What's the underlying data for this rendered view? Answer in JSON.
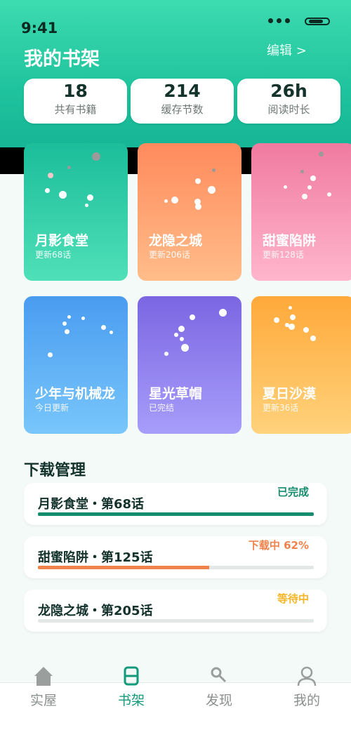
{
  "status_bar": {
    "time": "9:41"
  },
  "header": {
    "title": "我的书架",
    "edit_label": "编辑 >"
  },
  "stats": [
    {
      "value": "18",
      "label": "共有书籍"
    },
    {
      "value": "214",
      "label": "缓存节数"
    },
    {
      "value": "26h",
      "label": "阅读时长"
    }
  ],
  "books": [
    {
      "title": "月影食堂",
      "status": "更新68话",
      "gradient": [
        "#1bbd9a",
        "#4fe0b8"
      ]
    },
    {
      "title": "龙隐之城",
      "status": "更新206话",
      "gradient": [
        "#ff8a5c",
        "#ffbd8a"
      ]
    },
    {
      "title": "甜蜜陷阱",
      "status": "更新128话",
      "gradient": [
        "#f07aa0",
        "#ffb6cc"
      ]
    },
    {
      "title": "少年与机械龙",
      "status": "今日更新",
      "gradient": [
        "#4a9cf0",
        "#78c6fb"
      ]
    },
    {
      "title": "星光草帽",
      "status": "已完结",
      "gradient": [
        "#7b66e2",
        "#a79dfa"
      ]
    },
    {
      "title": "夏日沙漠",
      "status": "更新36话",
      "gradient": [
        "#ffa93a",
        "#ffd27c"
      ]
    }
  ],
  "downloads": {
    "section_title": "下载管理",
    "items": [
      {
        "title": "月影食堂・第68话",
        "status": "已完成",
        "status_color": "#148c6e",
        "progress": 1.0,
        "bar_color": "#148c6e"
      },
      {
        "title": "甜蜜陷阱・第125话",
        "status": "下载中 62%",
        "status_color": "#f0834c",
        "progress": 0.62,
        "bar_color": "#f0834c"
      },
      {
        "title": "龙隐之城・第205话",
        "status": "等待中",
        "status_color": "#f5b423",
        "progress": 0.0,
        "bar_color": "#f5b423"
      }
    ]
  },
  "tabbar": {
    "tabs": [
      {
        "label": "实屋",
        "icon": "house-icon",
        "active": false
      },
      {
        "label": "书架",
        "icon": "bookshelf-icon",
        "active": true
      },
      {
        "label": "发现",
        "icon": "magnifier-icon",
        "active": false
      },
      {
        "label": "我的",
        "icon": "person-icon",
        "active": false
      }
    ]
  },
  "colors": {
    "accent": "#129a7a",
    "header_top": "#3ddbb0",
    "header_bottom": "#16b596"
  }
}
